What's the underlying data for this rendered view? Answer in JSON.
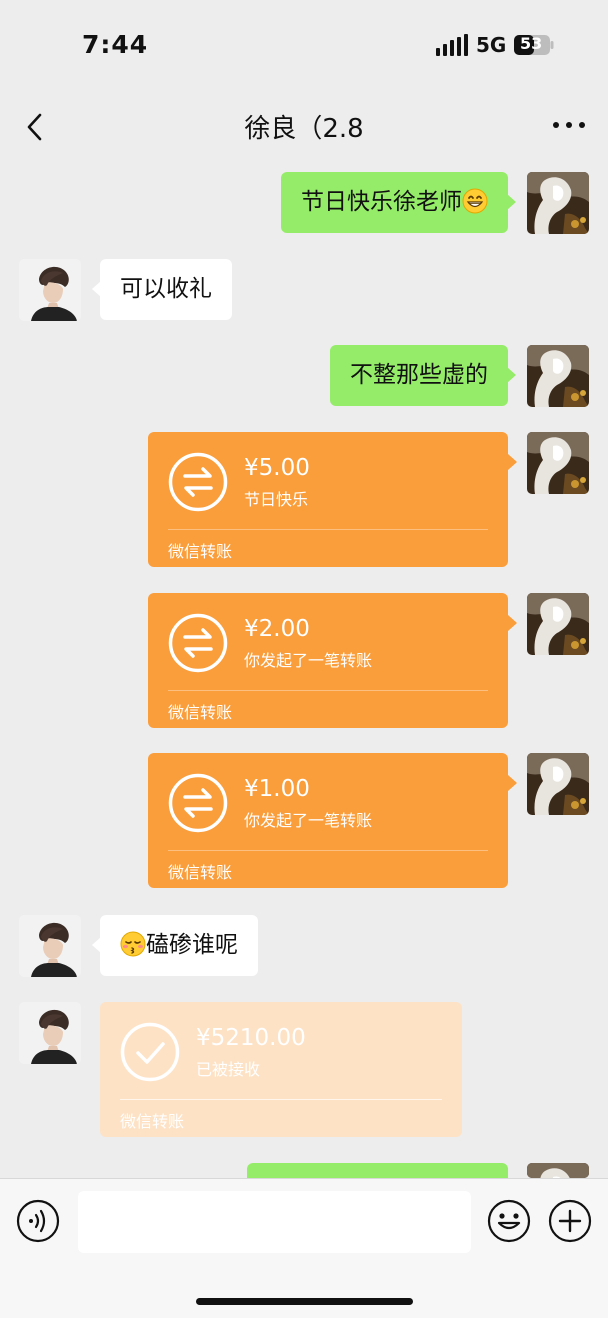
{
  "status_bar": {
    "time": "7:44",
    "network": "5G",
    "battery": "53"
  },
  "header": {
    "title": "徐良（2.8",
    "back_icon": "chevron-left-icon",
    "more_icon": "more-horizontal-icon"
  },
  "messages": [
    {
      "side": "right",
      "type": "text",
      "text": "节日快乐徐老师",
      "emoji": "grinning-face-icon"
    },
    {
      "side": "left",
      "type": "text",
      "text": "可以收礼"
    },
    {
      "side": "right",
      "type": "text",
      "text": "不整那些虚的"
    },
    {
      "side": "right",
      "type": "transfer",
      "amount": "¥5.00",
      "memo": "节日快乐",
      "label": "微信转账"
    },
    {
      "side": "right",
      "type": "transfer",
      "amount": "¥2.00",
      "memo": "你发起了一笔转账",
      "label": "微信转账"
    },
    {
      "side": "right",
      "type": "transfer",
      "amount": "¥1.00",
      "memo": "你发起了一笔转账",
      "label": "微信转账"
    },
    {
      "side": "left",
      "type": "text",
      "text": "磕碜谁呢",
      "emoji": "kissing-face-icon"
    },
    {
      "side": "left",
      "type": "transfer",
      "amount": "¥5210.00",
      "memo": "已被接收",
      "label": "微信转账",
      "status": "received"
    }
  ],
  "input_bar": {
    "placeholder": "",
    "voice_icon": "voice-icon",
    "emoji_icon": "smile-icon",
    "plus_icon": "plus-icon"
  },
  "colors": {
    "background": "#ededed",
    "sent_bubble": "#95ec69",
    "received_bubble": "#ffffff",
    "transfer": "#fa9d3b",
    "transfer_received": "#fde2c6"
  }
}
